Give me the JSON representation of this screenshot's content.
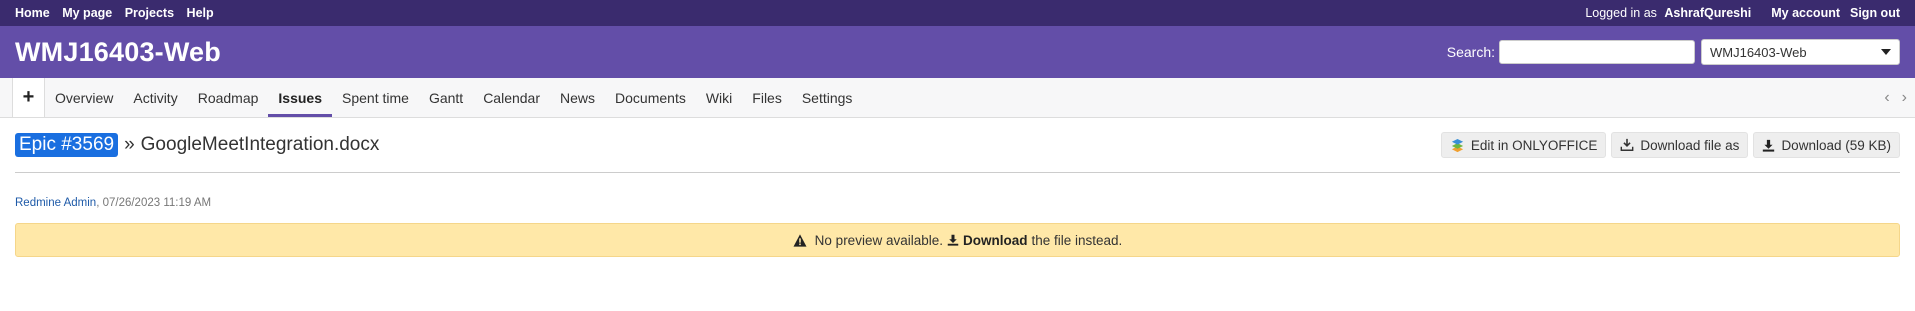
{
  "top_menu": {
    "left": [
      "Home",
      "My page",
      "Projects",
      "Help"
    ],
    "logged_as_prefix": "Logged in as",
    "username": "AshrafQureshi",
    "my_account": "My account",
    "sign_out": "Sign out"
  },
  "header": {
    "project_title": "WMJ16403-Web",
    "search_label": "Search:",
    "search_value": "",
    "project_select_value": "WMJ16403-Web"
  },
  "main_menu": {
    "new_label": "+",
    "tabs": [
      "Overview",
      "Activity",
      "Roadmap",
      "Issues",
      "Spent time",
      "Gantt",
      "Calendar",
      "News",
      "Documents",
      "Wiki",
      "Files",
      "Settings"
    ],
    "selected_tab": "Issues",
    "prev_icon": "‹",
    "next_icon": "›"
  },
  "attachment": {
    "epic_link": "Epic #3569",
    "separator": "»",
    "filename": "GoogleMeetIntegration.docx",
    "actions": {
      "edit": "Edit in ONLYOFFICE",
      "download_as": "Download file as",
      "download": "Download (59 KB)"
    },
    "author": "Redmine Admin",
    "timestamp": ", 07/26/2023 11:19 AM"
  },
  "flash": {
    "message_prefix": "No preview available.",
    "download_link": "Download",
    "message_suffix": "the file instead."
  },
  "colors": {
    "top_bar": "#3a2b6e",
    "header": "#634ea8",
    "epic_highlight": "#1a6fe0",
    "flash_bg": "#ffe8a8"
  }
}
